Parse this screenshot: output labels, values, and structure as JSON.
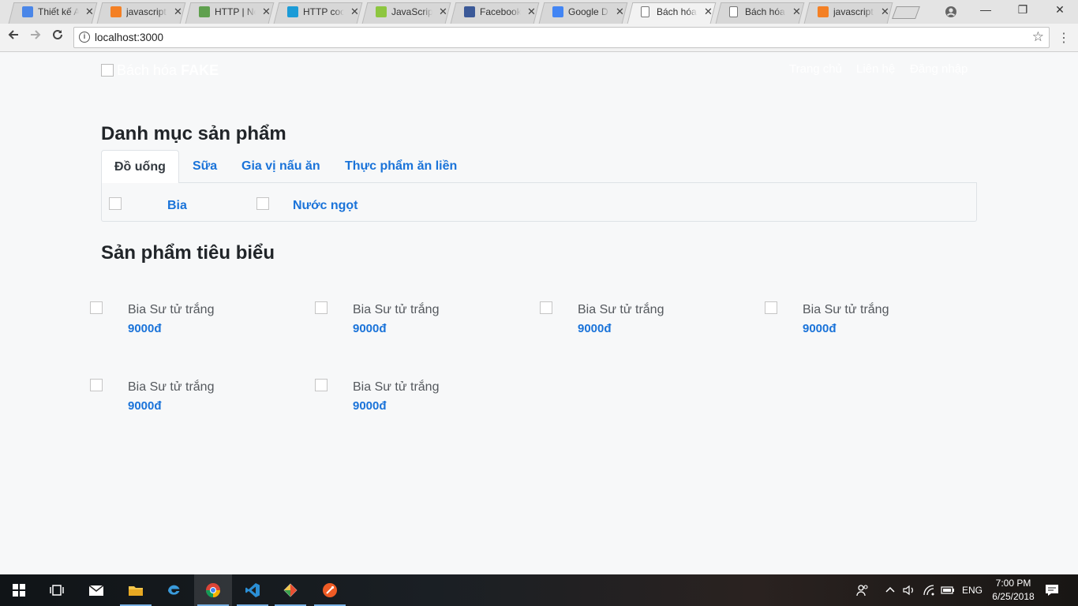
{
  "browser": {
    "tabs": [
      {
        "title": "Thiết kế A",
        "favicon_color": "#4a86e8",
        "favicon": "docs-icon"
      },
      {
        "title": "javascript",
        "favicon_color": "#f48024",
        "favicon": "stackoverflow-icon"
      },
      {
        "title": "HTTP | No",
        "favicon_color": "#5fa04e",
        "favicon": "nodejs-icon"
      },
      {
        "title": "HTTP coo",
        "favicon_color": "#1b9bd7",
        "favicon": "mdn-icon"
      },
      {
        "title": "JavaScript",
        "favicon_color": "#8dc63f",
        "favicon": "w3schools-icon"
      },
      {
        "title": "Facebook",
        "favicon_color": "#3b5998",
        "favicon": "facebook-icon"
      },
      {
        "title": "Google D",
        "favicon_color": "#4285f4",
        "favicon": "google-drive-icon"
      },
      {
        "title": "Bách hóa",
        "favicon_color": "#ffffff",
        "favicon": "page-icon",
        "active": true
      },
      {
        "title": "Bách hóa",
        "favicon_color": "#ffffff",
        "favicon": "page-icon"
      },
      {
        "title": "javascript",
        "favicon_color": "#f48024",
        "favicon": "stackoverflow-icon"
      }
    ],
    "tab_close": "✕",
    "url": "localhost:3000",
    "window_controls": {
      "minimize": "—",
      "restore": "❐",
      "close": "✕"
    }
  },
  "site": {
    "brand_plain": "Bách hóa ",
    "brand_bold": "FAKE",
    "nav": [
      "Trang chủ",
      "Liên hệ",
      "Đăng nhập"
    ],
    "categories_heading": "Danh mục sản phẩm",
    "category_tabs": [
      "Đồ uống",
      "Sữa",
      "Gia vị nấu ăn",
      "Thực phẩm ăn liền"
    ],
    "active_category": 0,
    "subcategories": [
      "Bia",
      "Nước ngọt"
    ],
    "featured_heading": "Sản phẩm tiêu biểu",
    "products": [
      {
        "name": "Bia Sư tử trắng",
        "price": "9000đ"
      },
      {
        "name": "Bia Sư tử trắng",
        "price": "9000đ"
      },
      {
        "name": "Bia Sư tử trắng",
        "price": "9000đ"
      },
      {
        "name": "Bia Sư tử trắng",
        "price": "9000đ"
      },
      {
        "name": "Bia Sư tử trắng",
        "price": "9000đ"
      },
      {
        "name": "Bia Sư tử trắng",
        "price": "9000đ"
      }
    ]
  },
  "taskbar": {
    "apps": [
      "start-icon",
      "task-view-icon",
      "mail-icon",
      "file-explorer-icon",
      "edge-icon",
      "chrome-icon",
      "vscode-icon",
      "git-icon",
      "postman-icon"
    ],
    "language": "ENG",
    "time": "7:00 PM",
    "date": "6/25/2018"
  },
  "colors": {
    "link": "#1a73d9",
    "text": "#212529",
    "page_bg": "#f7f8f9"
  }
}
